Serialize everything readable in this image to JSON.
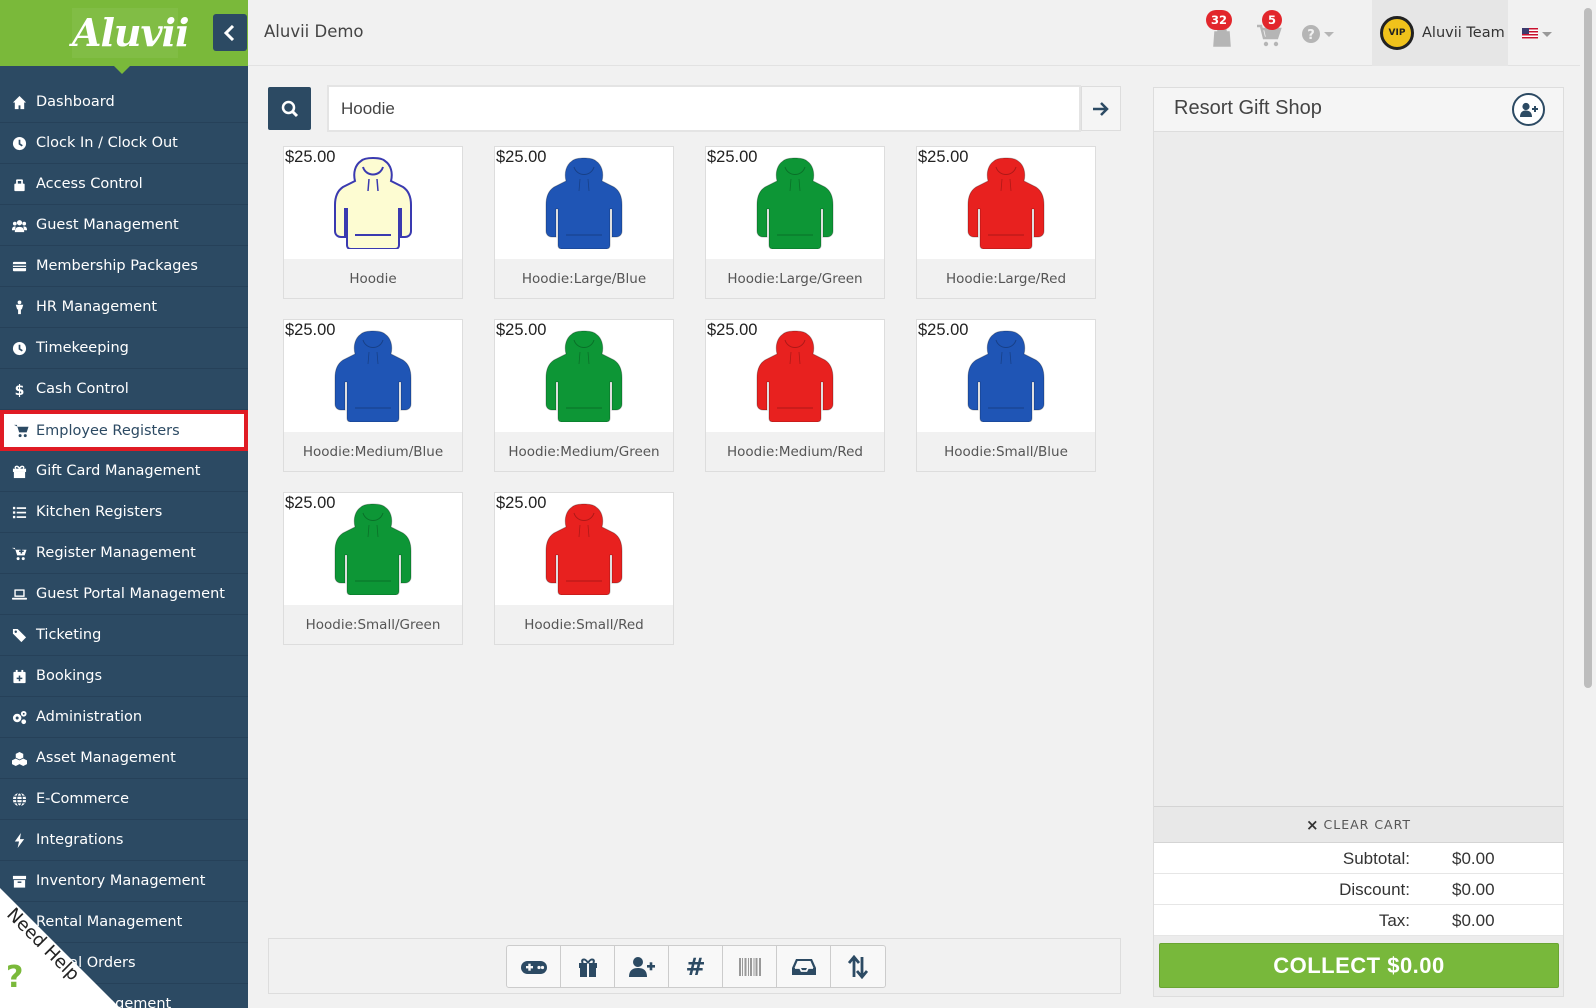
{
  "sidebar": {
    "logo": "Aluvii",
    "items": [
      {
        "label": "Dashboard",
        "icon": "home-icon"
      },
      {
        "label": "Clock In / Clock Out",
        "icon": "clock-icon"
      },
      {
        "label": "Access Control",
        "icon": "lock-icon"
      },
      {
        "label": "Guest Management",
        "icon": "users-icon"
      },
      {
        "label": "Membership Packages",
        "icon": "card-icon"
      },
      {
        "label": "HR Management",
        "icon": "person-icon"
      },
      {
        "label": "Timekeeping",
        "icon": "clock-icon"
      },
      {
        "label": "Cash Control",
        "icon": "dollar-icon"
      },
      {
        "label": "Employee Registers",
        "icon": "cart-icon",
        "active": true
      },
      {
        "label": "Gift Card Management",
        "icon": "gift-icon"
      },
      {
        "label": "Kitchen Registers",
        "icon": "list-icon"
      },
      {
        "label": "Register Management",
        "icon": "cart-plus-icon"
      },
      {
        "label": "Guest Portal Management",
        "icon": "laptop-icon"
      },
      {
        "label": "Ticketing",
        "icon": "ticket-icon"
      },
      {
        "label": "Bookings",
        "icon": "calendar-icon"
      },
      {
        "label": "Administration",
        "icon": "gears-icon"
      },
      {
        "label": "Asset Management",
        "icon": "cubes-icon"
      },
      {
        "label": "E-Commerce",
        "icon": "globe-icon"
      },
      {
        "label": "Integrations",
        "icon": "bolt-icon"
      },
      {
        "label": "Inventory Management",
        "icon": "archive-icon"
      },
      {
        "label": "Rental Management",
        "icon": "rental-icon"
      },
      {
        "label": "Rental Orders",
        "icon": "orders-icon"
      },
      {
        "label": "Lane Management",
        "icon": "lane-icon"
      }
    ],
    "need_help": "Need Help",
    "need_help_icon": "?"
  },
  "topbar": {
    "title": "Aluvii Demo",
    "bag_badge": "32",
    "cart_badge": "5",
    "user_name": "Aluvii Team",
    "avatar_text": "VIP"
  },
  "search": {
    "value": "Hoodie",
    "placeholder": ""
  },
  "products": [
    {
      "price": "$25.00",
      "name": "Hoodie",
      "color": "#fdfcd2",
      "outline": true
    },
    {
      "price": "$25.00",
      "name": "Hoodie:Large/Blue",
      "color": "#1f55b5"
    },
    {
      "price": "$25.00",
      "name": "Hoodie:Large/Green",
      "color": "#0d9636"
    },
    {
      "price": "$25.00",
      "name": "Hoodie:Large/Red",
      "color": "#e8211f"
    },
    {
      "price": "$25.00",
      "name": "Hoodie:Medium/Blue",
      "color": "#1f55b5"
    },
    {
      "price": "$25.00",
      "name": "Hoodie:Medium/Green",
      "color": "#0d9636"
    },
    {
      "price": "$25.00",
      "name": "Hoodie:Medium/Red",
      "color": "#e8211f"
    },
    {
      "price": "$25.00",
      "name": "Hoodie:Small/Blue",
      "color": "#1f55b5"
    },
    {
      "price": "$25.00",
      "name": "Hoodie:Small/Green",
      "color": "#0d9636"
    },
    {
      "price": "$25.00",
      "name": "Hoodie:Small/Red",
      "color": "#e8211f"
    }
  ],
  "toolbar": {
    "buttons": [
      "gamepad-icon",
      "gift-icon",
      "user-plus-icon",
      "hash-icon",
      "barcode-icon",
      "inbox-icon",
      "sort-icon"
    ],
    "hash_label": "#"
  },
  "cart": {
    "title": "Resort Gift Shop",
    "clear_label": "CLEAR CART",
    "clear_icon": "×",
    "subtotal_label": "Subtotal:",
    "subtotal_value": "$0.00",
    "discount_label": "Discount:",
    "discount_value": "$0.00",
    "tax_label": "Tax:",
    "tax_value": "$0.00",
    "collect_label": "COLLECT $0.00"
  },
  "colors": {
    "sidebar": "#2c4a63",
    "brand_green": "#7ab93a",
    "active_border": "#e01b24",
    "badge_red": "#e2262c"
  }
}
